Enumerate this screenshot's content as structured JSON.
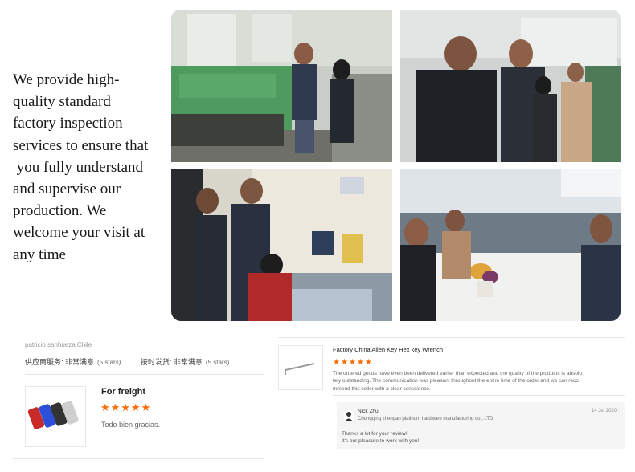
{
  "intro": {
    "lines": [
      "We provide high-",
      "quality standard",
      "factory inspection",
      "services to ensure that",
      " you fully understand",
      "and supervise our",
      "production. We",
      "welcome your visit at",
      "any time"
    ]
  },
  "photos": [
    {
      "icon": "factory-inspection-photo-1"
    },
    {
      "icon": "factory-inspection-photo-2"
    },
    {
      "icon": "factory-inspection-photo-3"
    },
    {
      "icon": "factory-meeting-photo-4"
    }
  ],
  "review1": {
    "reviewer": "patricio sanhueza,Chile",
    "ratings": [
      {
        "label": "供应商服务: 非常满意",
        "stars": "(5 stars)"
      },
      {
        "label": "按时发货: 非常满意",
        "stars": "(5 stars)"
      }
    ],
    "product_title": "For freight",
    "stars": "★★★★★",
    "text": "Todo bien gracias."
  },
  "review2": {
    "product_title": "Factory China Allen Key Hex key Wrench",
    "stars": "★★★★★",
    "text_lines": [
      "The ordered goods have even been delivered earlier than expected and the quality of the products is absolu",
      "tely outstanding. The communication was pleasant throughout the entire time of the order and we can reco",
      "mmend this seller with a clear conscience."
    ],
    "reply": {
      "name": "Nick Zhu",
      "company": "Chongqing zhengan platinum hardware manufacturing co., LTD.",
      "date": "14 Jul 2020",
      "message_lines": [
        "Thanks a lot for your review!",
        "It's our pleasure to work with you!"
      ]
    }
  },
  "colors": {
    "star": "#ff6a00",
    "reply_bg": "#f5f5f5"
  }
}
